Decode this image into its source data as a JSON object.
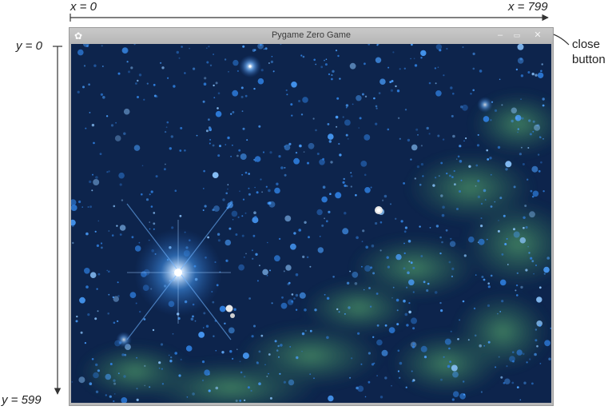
{
  "annotations": {
    "x_start": "x = 0",
    "x_end": "x = 799",
    "y_start": "y = 0",
    "y_end": "y = 599",
    "close_callout": "close\nbutton"
  },
  "window": {
    "title": "Pygame Zero Game",
    "minimize_glyph": "–",
    "maximize_glyph": "▭",
    "close_glyph": "✕",
    "app_icon": "pygame-icon"
  },
  "scene": {
    "description_icon": "starfield-background",
    "colors": {
      "space_dark": "#0a1a38",
      "nebula_green": "#3d8f5e",
      "star_blue": "#3a8fe8",
      "bright_star": "#ffffff"
    }
  }
}
